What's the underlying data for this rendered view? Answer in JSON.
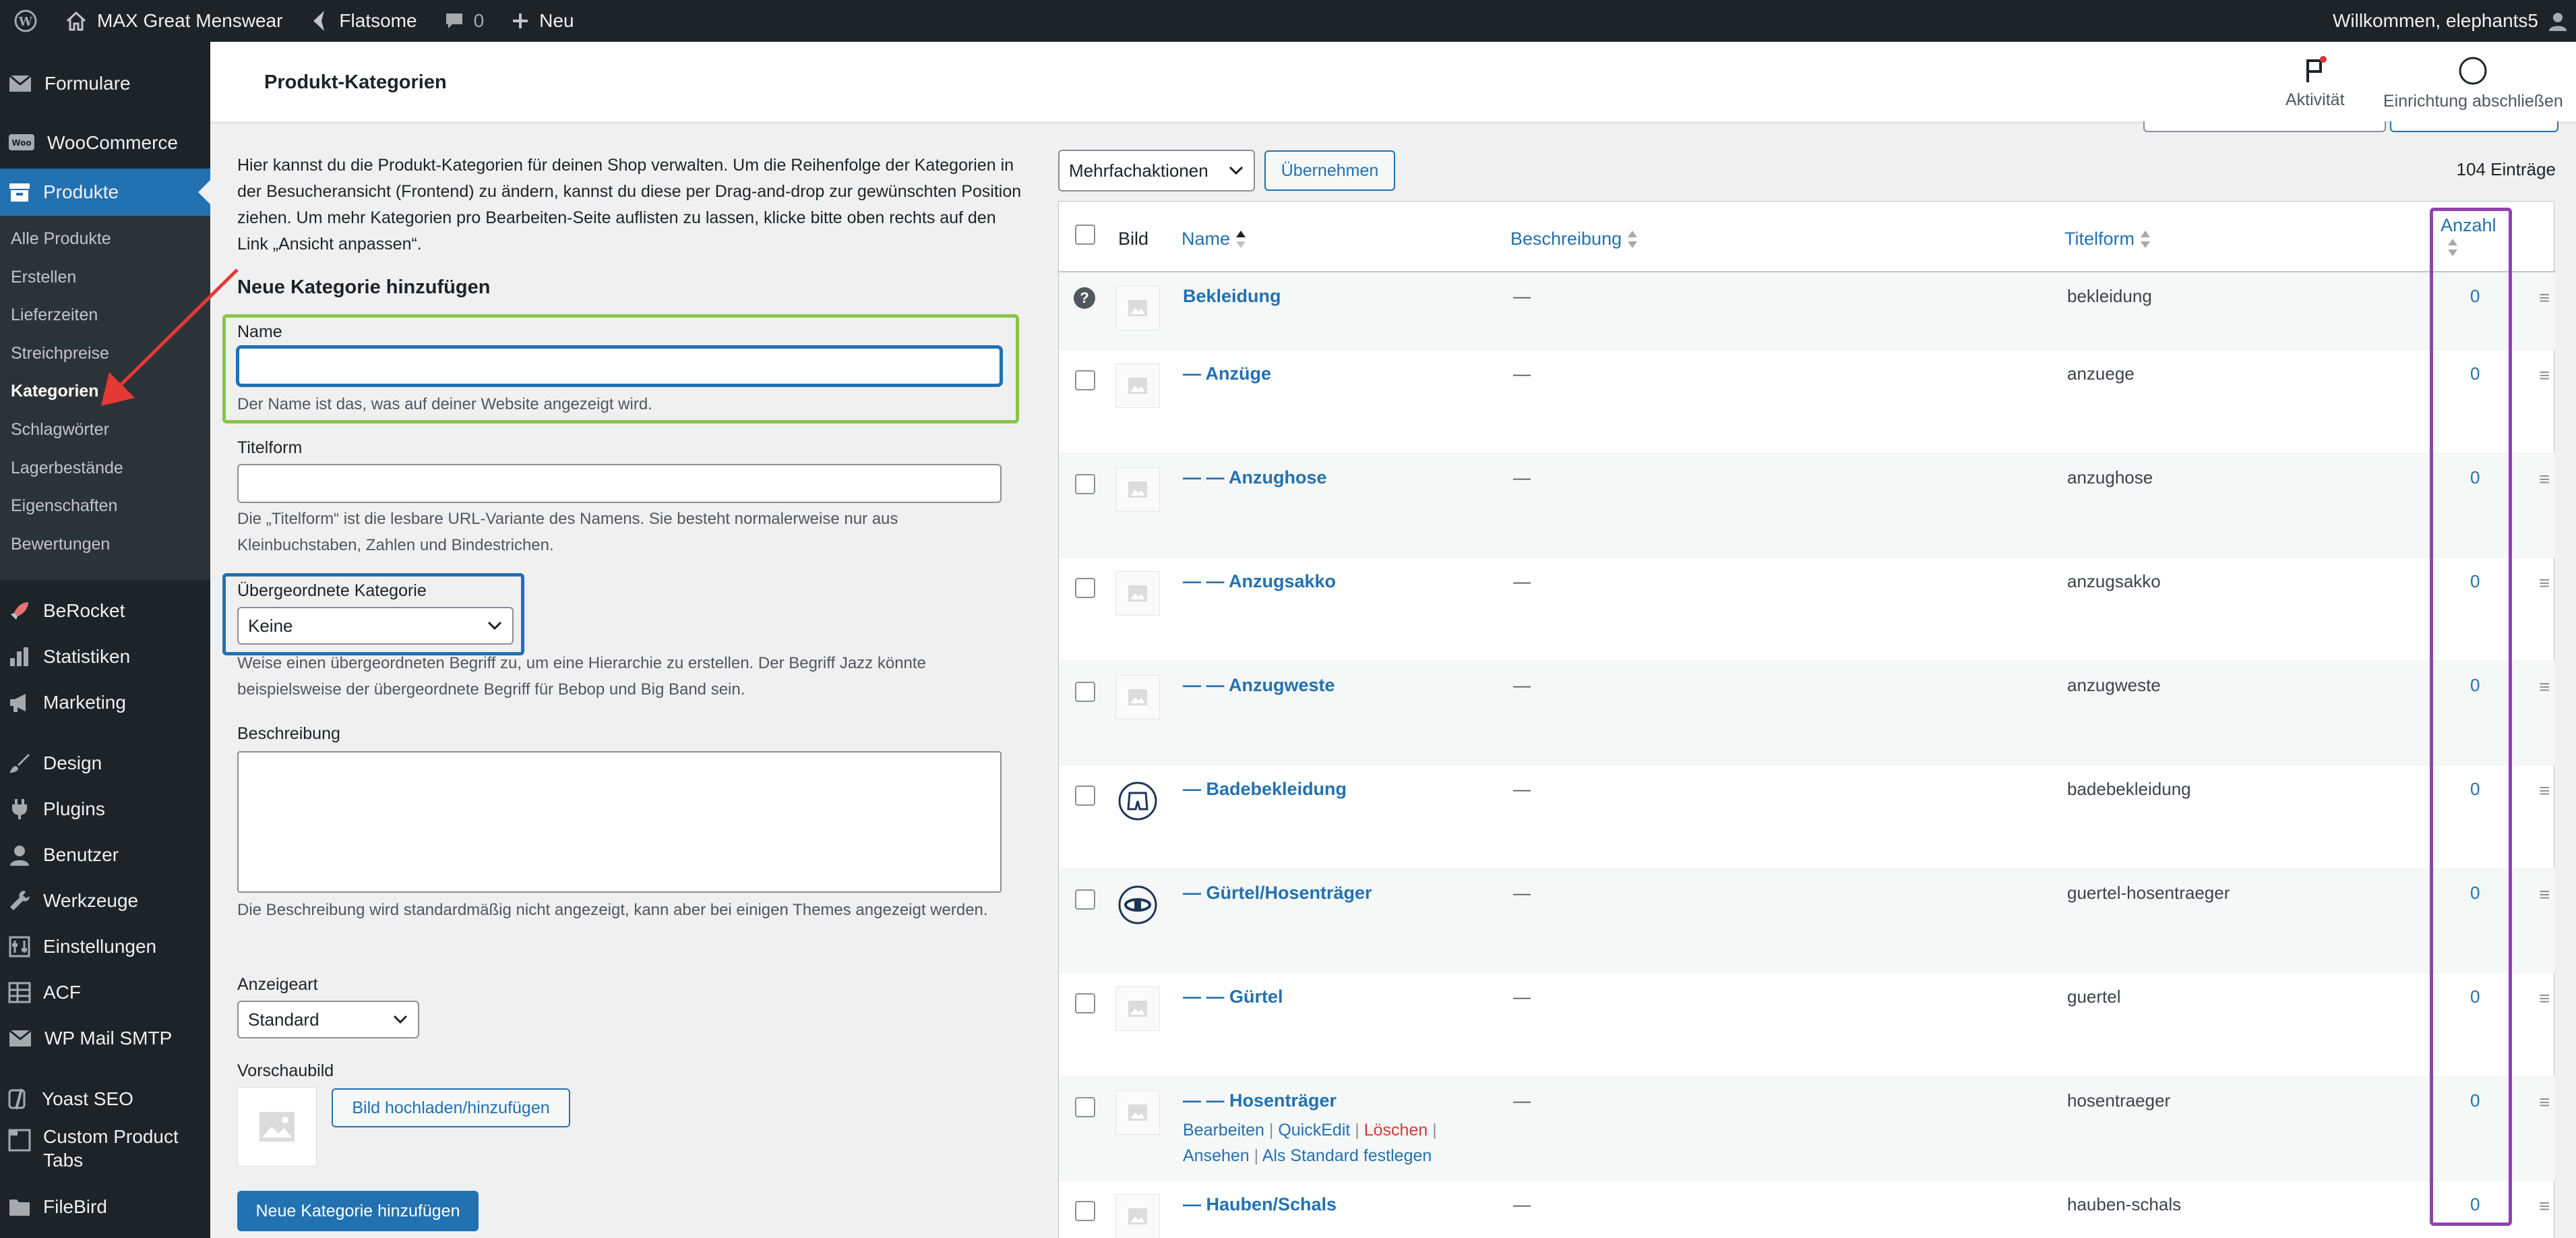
{
  "adminbar": {
    "site_name": "MAX Great Menswear",
    "theme": "Flatsome",
    "comments_count": "0",
    "new_label": "Neu",
    "greeting": "Willkommen, elephants5"
  },
  "sidebar": {
    "items": {
      "formulare": "Formulare",
      "woocommerce": "WooCommerce",
      "produkte": "Produkte",
      "berocket": "BeRocket",
      "statistiken": "Statistiken",
      "marketing": "Marketing",
      "design": "Design",
      "plugins": "Plugins",
      "benutzer": "Benutzer",
      "werkzeuge": "Werkzeuge",
      "einstellungen": "Einstellungen",
      "acf": "ACF",
      "wpmail": "WP Mail SMTP",
      "yoast": "Yoast SEO",
      "custom_tabs": "Custom Product Tabs",
      "filebird": "FileBird"
    },
    "submenu": {
      "alle": "Alle Produkte",
      "erstellen": "Erstellen",
      "lieferzeiten": "Lieferzeiten",
      "streichpreise": "Streichpreise",
      "kategorien": "Kategorien",
      "schlagwoerter": "Schlagwörter",
      "lagerbestaende": "Lagerbestände",
      "eigenschaften": "Eigenschaften",
      "bewertungen": "Bewertungen"
    }
  },
  "header": {
    "title": "Produkt-Kategorien",
    "aktivitaet": "Aktivität",
    "einrichtung": "Einrichtung abschließen"
  },
  "form": {
    "intro": "Hier kannst du die Produkt-Kategorien für deinen Shop verwalten. Um die Reihenfolge der Kategorien in der Besucheransicht (Frontend) zu ändern, kannst du diese per Drag-and-drop zur gewünschten Position ziehen. Um mehr Kategorien pro Bearbeiten-Seite auflisten zu lassen, klicke bitte oben rechts auf den Link „Ansicht anpassen“.",
    "heading": "Neue Kategorie hinzufügen",
    "name_label": "Name",
    "name_value": "",
    "name_help": "Der Name ist das, was auf deiner Website angezeigt wird.",
    "slug_label": "Titelform",
    "slug_value": "",
    "slug_help": "Die „Titelform“ ist die lesbare URL-Variante des Namens. Sie besteht normalerweise nur aus Kleinbuchstaben, Zahlen und Bindestrichen.",
    "parent_label": "Übergeordnete Kategorie",
    "parent_value": "Keine",
    "parent_help": "Weise einen übergeordneten Begriff zu, um eine Hierarchie zu erstellen. Der Begriff Jazz könnte beispielsweise der übergeordnete Begriff für Bebop und Big Band sein.",
    "desc_label": "Beschreibung",
    "desc_help": "Die Beschreibung wird standardmäßig nicht angezeigt, kann aber bei einigen Themes angezeigt werden.",
    "display_label": "Anzeigeart",
    "display_value": "Standard",
    "thumb_label": "Vorschaubild",
    "upload_button": "Bild hochladen/hinzufügen",
    "submit_button": "Neue Kategorie hinzufügen"
  },
  "table": {
    "bulk_value": "Mehrfachaktionen",
    "apply_button": "Übernehmen",
    "count_label": "104 Einträge",
    "columns": {
      "bild": "Bild",
      "name": "Name",
      "beschreibung": "Beschreibung",
      "titelform": "Titelform",
      "anzahl": "Anzahl"
    },
    "rows": [
      {
        "name": "Bekleidung",
        "desc": "—",
        "slug": "bekleidung",
        "count": "0"
      },
      {
        "name": "— Anzüge",
        "desc": "—",
        "slug": "anzuege",
        "count": "0"
      },
      {
        "name": "— — Anzughose",
        "desc": "—",
        "slug": "anzughose",
        "count": "0"
      },
      {
        "name": "— — Anzugsakko",
        "desc": "—",
        "slug": "anzugsakko",
        "count": "0"
      },
      {
        "name": "— — Anzugweste",
        "desc": "—",
        "slug": "anzugweste",
        "count": "0"
      },
      {
        "name": "— Badebekleidung",
        "desc": "—",
        "slug": "badebekleidung",
        "count": "0"
      },
      {
        "name": "— Gürtel/Hosenträger",
        "desc": "—",
        "slug": "guertel-hosentraeger",
        "count": "0"
      },
      {
        "name": "— — Gürtel",
        "desc": "—",
        "slug": "guertel",
        "count": "0"
      },
      {
        "name": "— — Hosenträger",
        "desc": "—",
        "slug": "hosentraeger",
        "count": "0"
      },
      {
        "name": "— Hauben/Schals",
        "desc": "—",
        "slug": "hauben-schals",
        "count": "0"
      }
    ],
    "row_actions": {
      "bearbeiten": "Bearbeiten",
      "quickedit": "QuickEdit",
      "loeschen": "Löschen",
      "ansehen": "Ansehen",
      "standard": "Als Standard festlegen",
      "sep": "|"
    },
    "handle": "≡",
    "question": "?"
  },
  "colors": {
    "accent": "#2271b1",
    "highlight_green": "#8bc34a",
    "highlight_blue": "#2271b1",
    "highlight_purple": "#8e44ad",
    "arrow_red": "#e53935",
    "delete_red": "#d63638"
  }
}
